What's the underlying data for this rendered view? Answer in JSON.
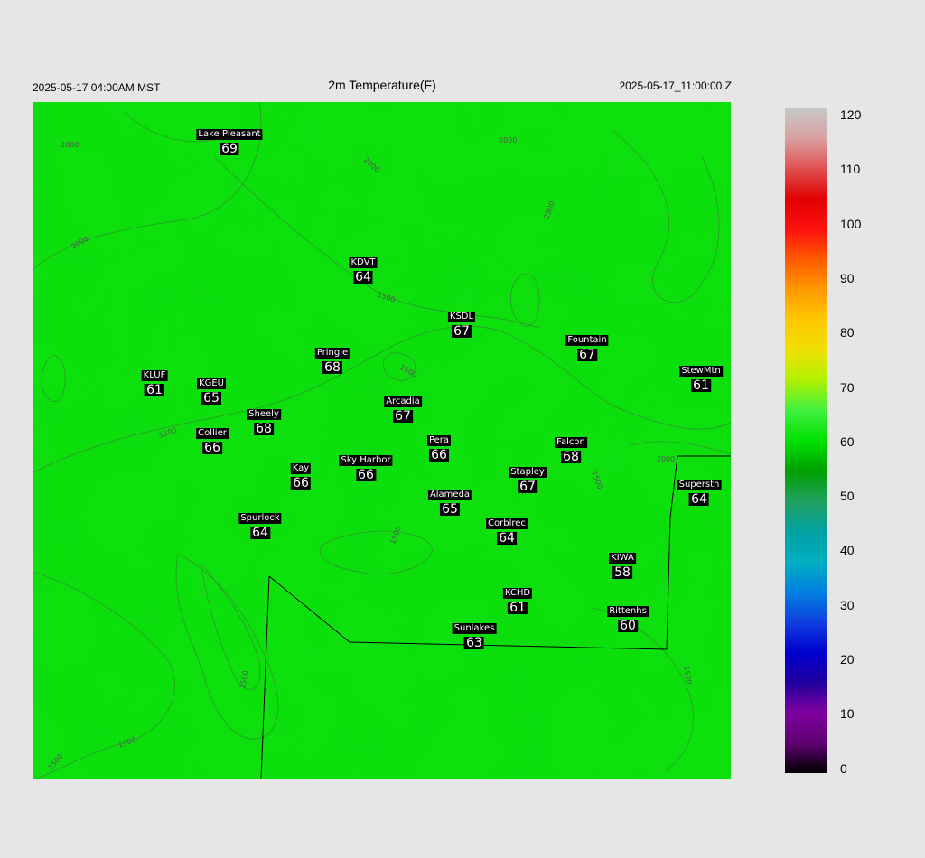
{
  "header": {
    "local_time": "2025-05-17 04:00AM MST",
    "title": "2m Temperature(F)",
    "valid_time": "2025-05-17_11:00:00 Z"
  },
  "map": {
    "fill_color": "#0fe00f",
    "contour_labels": [
      "2000",
      "2000",
      "2000",
      "1500",
      "1500",
      "1500",
      "1500",
      "1500",
      "1500",
      "1500",
      "2000",
      "2000",
      "2500",
      "1500",
      "1500"
    ],
    "stations": [
      {
        "name": "Lake Pleasant",
        "temp": "69"
      },
      {
        "name": "KDVT",
        "temp": "64"
      },
      {
        "name": "KSDL",
        "temp": "67"
      },
      {
        "name": "Fountain",
        "temp": "67"
      },
      {
        "name": "Pringle",
        "temp": "68"
      },
      {
        "name": "StewMtn",
        "temp": "61"
      },
      {
        "name": "KLUF",
        "temp": "61"
      },
      {
        "name": "KGEU",
        "temp": "65"
      },
      {
        "name": "Arcadia",
        "temp": "67"
      },
      {
        "name": "Sheely",
        "temp": "68"
      },
      {
        "name": "Collier",
        "temp": "66"
      },
      {
        "name": "Pera",
        "temp": "66"
      },
      {
        "name": "Falcon",
        "temp": "68"
      },
      {
        "name": "Kay",
        "temp": "66"
      },
      {
        "name": "Sky Harbor",
        "temp": "66"
      },
      {
        "name": "Stapley",
        "temp": "67"
      },
      {
        "name": "Superstn",
        "temp": "64"
      },
      {
        "name": "Alameda",
        "temp": "65"
      },
      {
        "name": "Spurlock",
        "temp": "64"
      },
      {
        "name": "Corblrec",
        "temp": "64"
      },
      {
        "name": "KIWA",
        "temp": "58"
      },
      {
        "name": "KCHD",
        "temp": "61"
      },
      {
        "name": "Rittenhs",
        "temp": "60"
      },
      {
        "name": "Sunlakes",
        "temp": "63"
      }
    ]
  },
  "colorbar": {
    "ticks": [
      "120",
      "110",
      "100",
      "90",
      "80",
      "70",
      "60",
      "50",
      "40",
      "30",
      "20",
      "10",
      "0"
    ],
    "colors": [
      "#c8c8c8",
      "#d9a0a0",
      "#e05050",
      "#e00000",
      "#ff1010",
      "#ff5a00",
      "#ff9a00",
      "#ffc800",
      "#f0e000",
      "#b0f000",
      "#40f040",
      "#00e000",
      "#00a000",
      "#20a060",
      "#00a0a0",
      "#00b0c0",
      "#0080e0",
      "#1040e0",
      "#0000d0",
      "#2000a0",
      "#8000a0",
      "#600070",
      "#000000"
    ]
  }
}
